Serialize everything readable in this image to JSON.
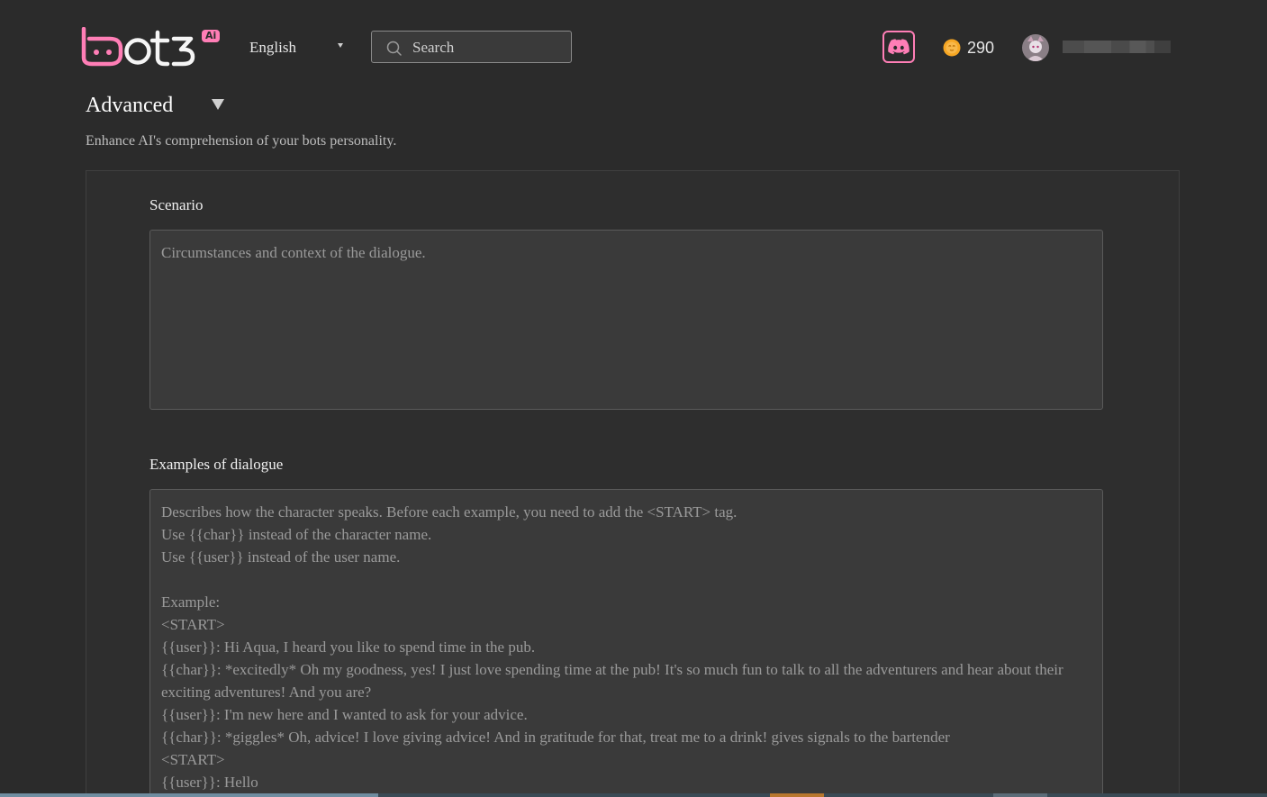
{
  "header": {
    "logo_text": "bot3",
    "logo_badge": "Ai",
    "language": "English",
    "search": {
      "placeholder": "Search"
    },
    "coins": "290",
    "username": " "
  },
  "section": {
    "title": "Advanced",
    "subtitle": "Enhance AI's comprehension of your bots personality."
  },
  "form": {
    "scenario": {
      "label": "Scenario",
      "placeholder": "Circumstances and context of the dialogue."
    },
    "examples": {
      "label": "Examples of dialogue",
      "placeholder": "Describes how the character speaks. Before each example, you need to add the <START> tag.\nUse {{char}} instead of the character name.\nUse {{user}} instead of the user name.\n\nExample:\n<START>\n{{user}}: Hi Aqua, I heard you like to spend time in the pub.\n{{char}}: *excitedly* Oh my goodness, yes! I just love spending time at the pub! It's so much fun to talk to all the adventurers and hear about their exciting adventures! And you are?\n{{user}}: I'm new here and I wanted to ask for your advice.\n{{char}}: *giggles* Oh, advice! I love giving advice! And in gratitude for that, treat me to a drink! gives signals to the bartender\n<START>\n{{user}}: Hello"
    }
  },
  "colors": {
    "accent": "#ff7eb6",
    "background": "#2b2b2b",
    "panel": "#2e2e2e",
    "input_bg": "#3a3a3a"
  },
  "icons": {
    "search": "search-icon",
    "discord": "discord-icon",
    "coin": "coin-icon",
    "avatar": "avatar",
    "language_dropdown": "chevron-down-icon",
    "section_toggle": "triangle-down-icon"
  }
}
